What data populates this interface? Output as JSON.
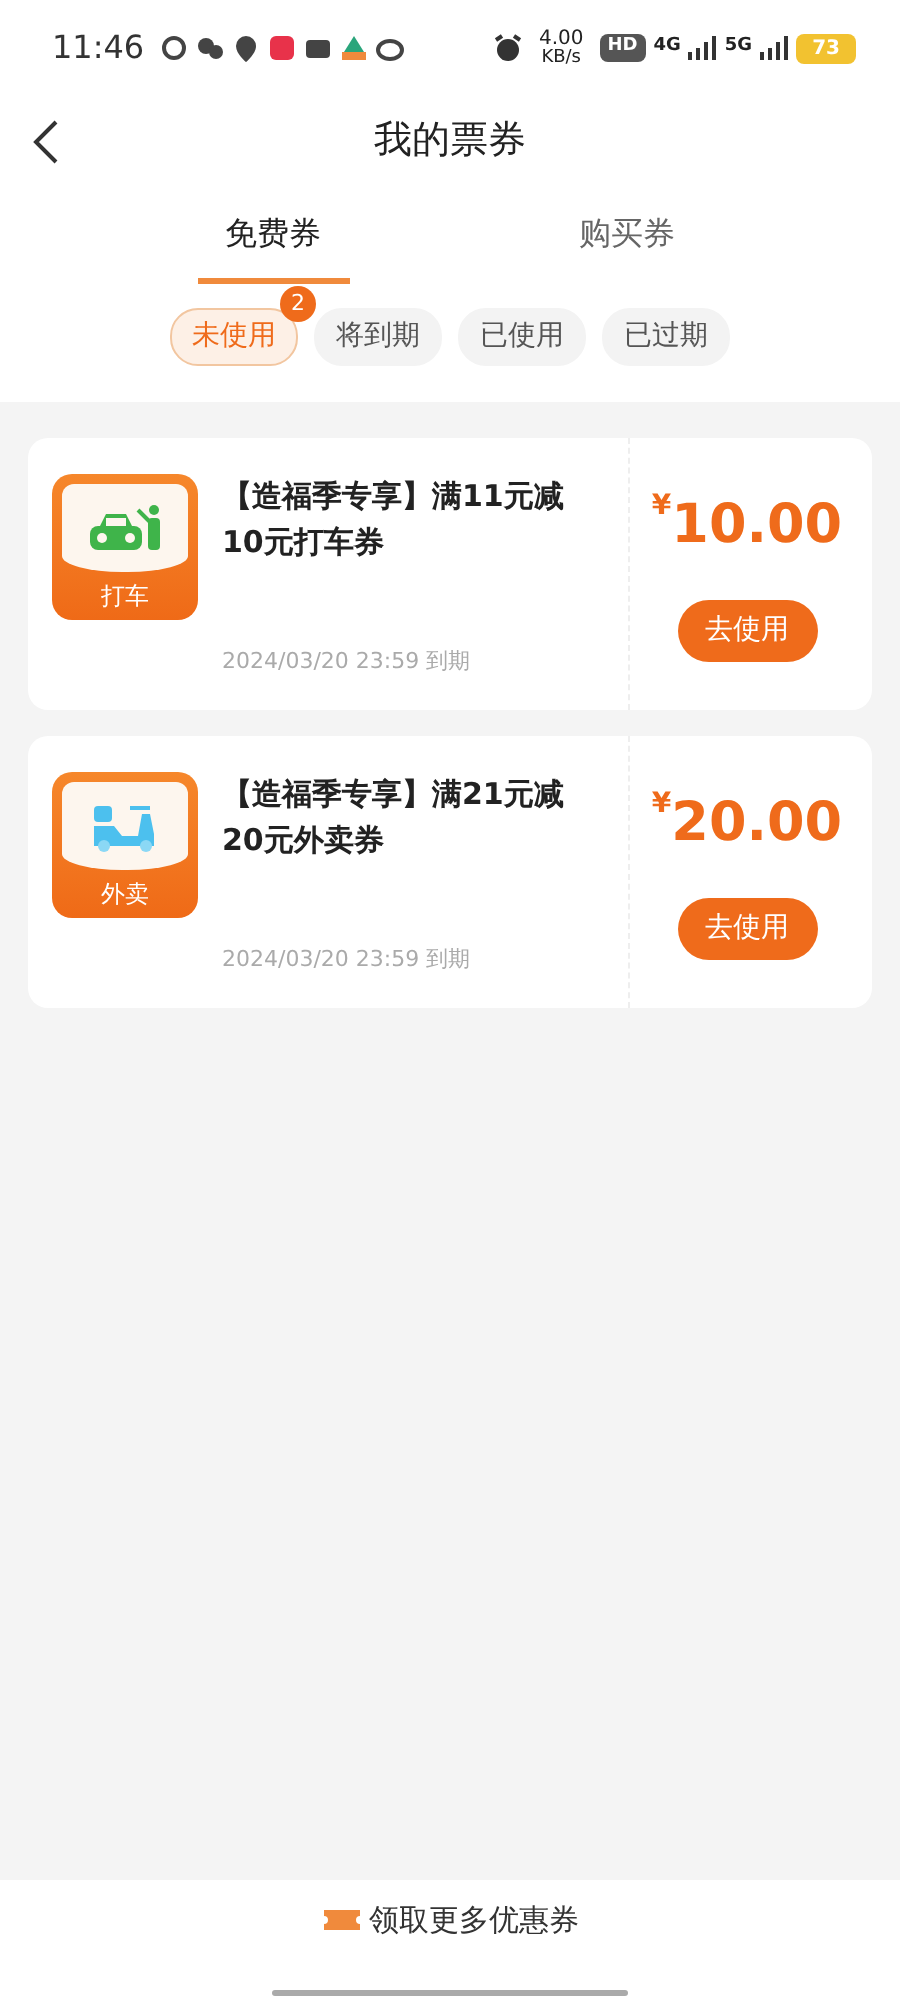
{
  "status_bar": {
    "time": "11:46",
    "net_speed": "4.00",
    "net_unit": "KB/s",
    "hd": "HD",
    "sim1": "4G",
    "sim2": "5G",
    "battery": "73"
  },
  "header": {
    "title": "我的票券"
  },
  "tabs": [
    {
      "label": "免费券",
      "selected": true
    },
    {
      "label": "购买券",
      "selected": false
    }
  ],
  "filters": [
    {
      "label": "未使用",
      "selected": true,
      "badge": "2"
    },
    {
      "label": "将到期",
      "selected": false
    },
    {
      "label": "已使用",
      "selected": false
    },
    {
      "label": "已过期",
      "selected": false
    }
  ],
  "coupons": [
    {
      "kind": "taxi",
      "icon_label": "打车",
      "title": "【造福季专享】满11元减10元打车券",
      "expiry": "2024/03/20 23:59 到期",
      "currency": "¥",
      "amount": "10.00",
      "button": "去使用"
    },
    {
      "kind": "delivery",
      "icon_label": "外卖",
      "title": "【造福季专享】满21元减20元外卖券",
      "expiry": "2024/03/20 23:59 到期",
      "currency": "¥",
      "amount": "20.00",
      "button": "去使用"
    }
  ],
  "footer": {
    "button": "领取更多优惠券"
  }
}
